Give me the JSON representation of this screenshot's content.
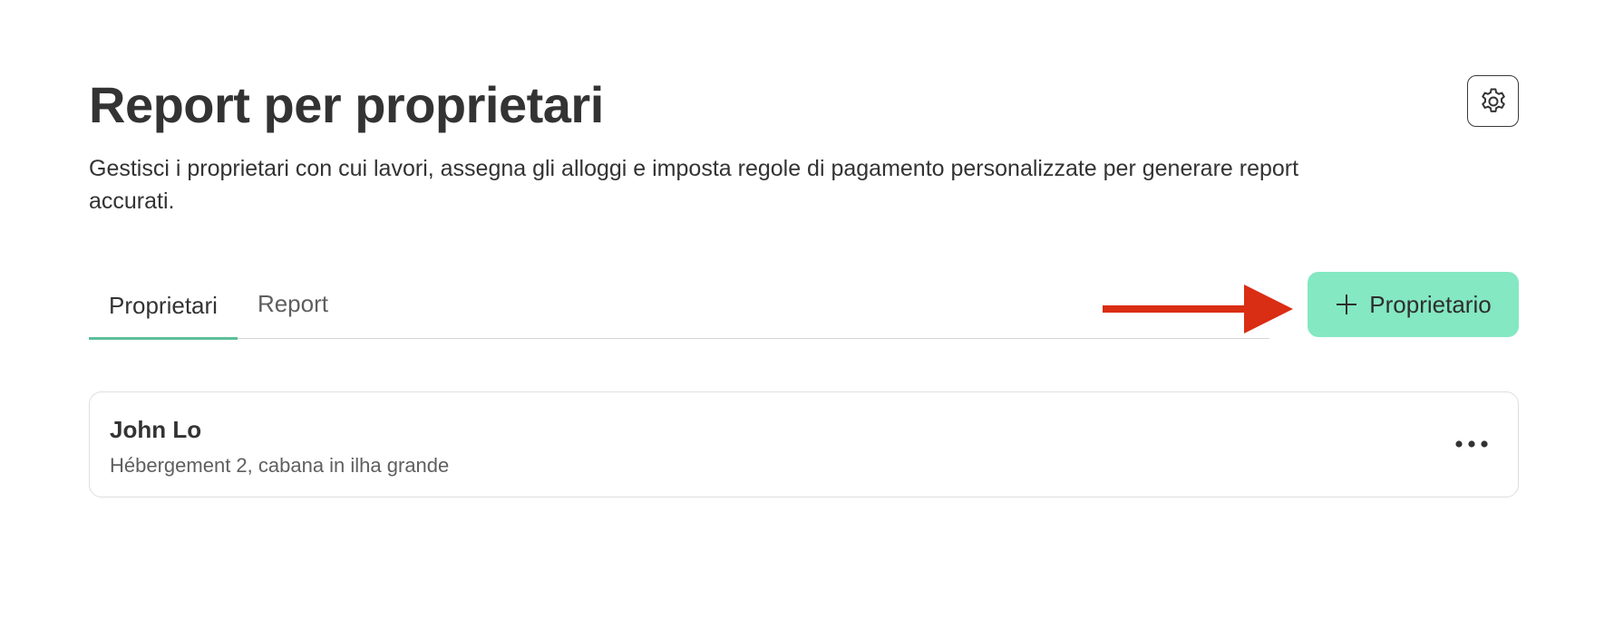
{
  "header": {
    "title": "Report per proprietari",
    "description": "Gestisci i proprietari con cui lavori, assegna gli alloggi e imposta regole di pagamento personalizzate per generare report accurati.",
    "settings_icon": "gear-icon"
  },
  "tabs": [
    {
      "label": "Proprietari",
      "active": true
    },
    {
      "label": "Report",
      "active": false
    }
  ],
  "add_owner_button": {
    "label": "Proprietario",
    "icon": "plus-icon",
    "color": "#84e8c2"
  },
  "annotation": {
    "icon": "arrow-right-icon",
    "color": "#d92d14"
  },
  "owners": [
    {
      "name": "John Lo",
      "properties": "Hébergement 2, cabana in ilha grande",
      "menu_icon": "more-horizontal-icon"
    }
  ],
  "colors": {
    "accent": "#5cbf9a",
    "text": "#333333",
    "muted_text": "#5f5f5f"
  }
}
